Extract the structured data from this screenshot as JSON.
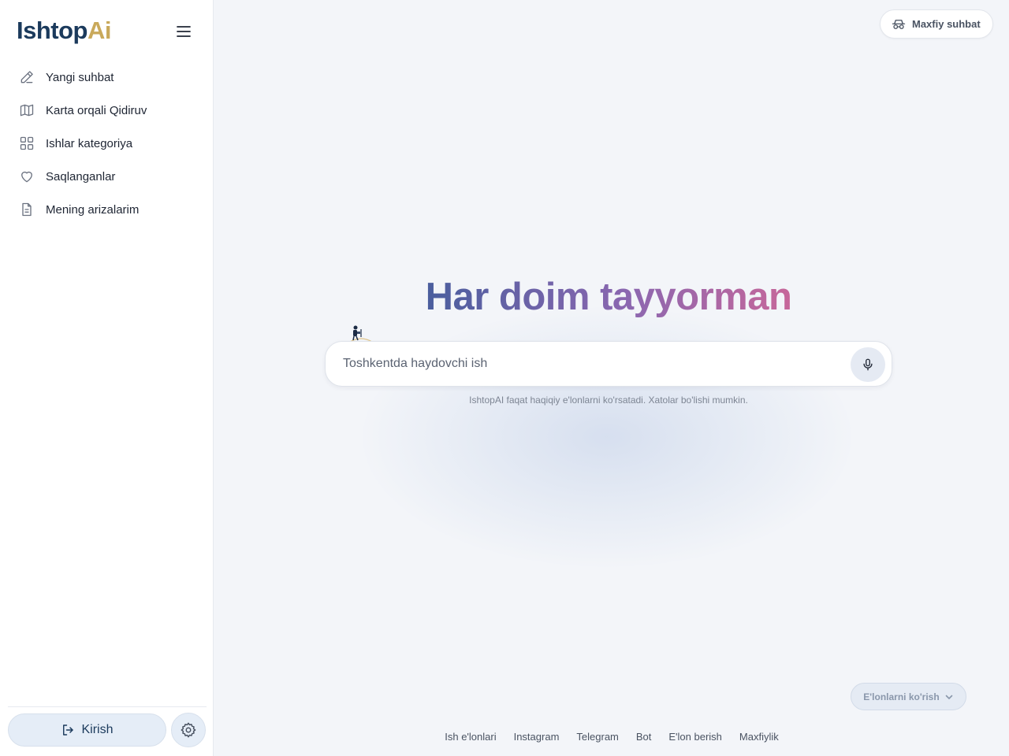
{
  "brand": {
    "part1": "Ishtop",
    "part2": "Ai"
  },
  "colors": {
    "brand_dark": "#1b3a5c",
    "brand_gold": "#c9a95b",
    "accent_bg": "#e5edf7"
  },
  "sidebar": {
    "items": [
      {
        "label": "Yangi suhbat",
        "icon": "pencil-icon"
      },
      {
        "label": "Karta orqali Qidiruv",
        "icon": "map-icon"
      },
      {
        "label": "Ishlar kategoriya",
        "icon": "grid-icon"
      },
      {
        "label": "Saqlanganlar",
        "icon": "heart-icon"
      },
      {
        "label": "Mening arizalarim",
        "icon": "document-icon"
      }
    ],
    "login_label": "Kirish"
  },
  "header": {
    "private_chat_label": "Maxfiy suhbat"
  },
  "main": {
    "hero_title": "Har doim tayyorman",
    "search_placeholder": "Toshkentda haydovchi ish",
    "disclaimer": "IshtopAI faqat haqiqiy e'lonlarni ko'rsatadi. Xatolar bo'lishi mumkin.",
    "listings_button": "E'lonlarni ko'rish"
  },
  "footer": {
    "links": [
      "Ish e'lonlari",
      "Instagram",
      "Telegram",
      "Bot",
      "E'lon berish",
      "Maxfiylik"
    ]
  }
}
